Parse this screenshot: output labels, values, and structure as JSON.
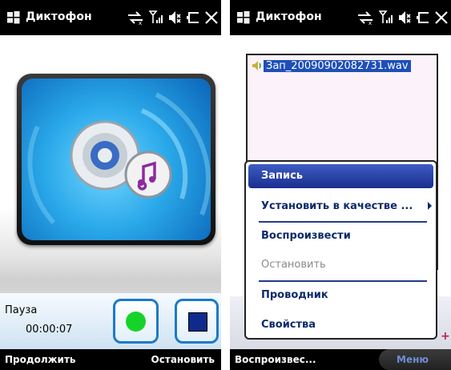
{
  "left_screen": {
    "app_title": "Диктофон",
    "status_label": "Пауза",
    "timer": "00:00:07",
    "softkeys": {
      "left": "Продолжить",
      "right": "Остановить"
    },
    "colors": {
      "record_dot": "#16d32a",
      "stop_square": "#0e2a8c",
      "button_border": "#1b7ac8"
    },
    "icons": [
      "windows-logo-icon",
      "data-connection-icon",
      "signal-strength-icon",
      "speaker-mute-icon",
      "battery-icon",
      "close-icon",
      "disc-music-icon",
      "record-icon",
      "stop-icon"
    ]
  },
  "right_screen": {
    "app_title": "Диктофон",
    "file": {
      "name": "Зап_20090902082731.wav",
      "selected": true
    },
    "menu": {
      "items": [
        {
          "label": "Запись",
          "state": "selected"
        },
        {
          "label": "Установить в качестве ...",
          "state": "submenu"
        },
        {
          "label": "Воспроизвести",
          "state": "enabled"
        },
        {
          "label": "Остановить",
          "state": "disabled"
        },
        {
          "label": "Проводник",
          "state": "enabled"
        },
        {
          "label": "Свойства",
          "state": "enabled"
        }
      ]
    },
    "softkeys": {
      "left": "Воспроизвес...",
      "right": "Меню"
    }
  }
}
